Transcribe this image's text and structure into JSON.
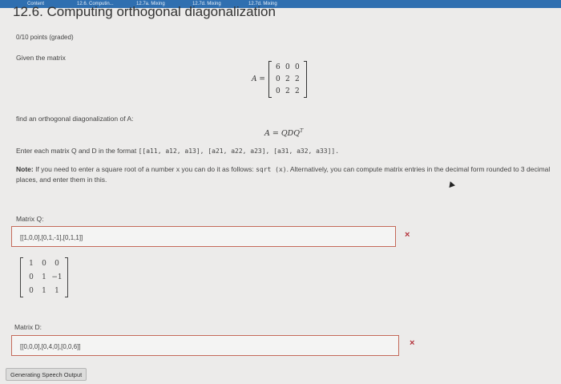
{
  "tabs": [
    {
      "label": "Content"
    },
    {
      "label": "12.6. Computin..."
    },
    {
      "label": "12.7a. Mixing"
    },
    {
      "label": "12.7d. Mixing"
    },
    {
      "label": "12.7d. Mixing"
    }
  ],
  "page_title": "12.6. Computing orthogonal diagonalization",
  "points": "0/10 points (graded)",
  "given_text": "Given the matrix",
  "matrix_A": {
    "lhs": "A =",
    "rows": [
      [
        "6",
        "0",
        "0"
      ],
      [
        "0",
        "2",
        "2"
      ],
      [
        "0",
        "2",
        "2"
      ]
    ]
  },
  "find_text": "find an orthogonal diagonalization of A:",
  "equation": {
    "lhs": "A = QDQ",
    "sup": "T"
  },
  "format_text": {
    "prefix": "Enter each matrix Q and D in the format",
    "code": "[[a11, a12, a13], [a21, a22, a23], [a31, a32, a33]]."
  },
  "note": {
    "label": "Note:",
    "text_1": " If you need to enter a square root of a number x you can do it as follows: ",
    "code": "sqrt (x)",
    "text_2": ". Alternatively, you can compute matrix entries in the decimal form rounded to 3 decimal places, and enter them in this."
  },
  "matrix_Q": {
    "label": "Matrix Q:",
    "value": "[[1,0,0],[0,1,-1],[0,1,1]]",
    "preview_rows": [
      [
        "1",
        "0",
        "0"
      ],
      [
        "0",
        "1",
        "−1"
      ],
      [
        "0",
        "1",
        "1"
      ]
    ],
    "status_mark": "×"
  },
  "matrix_D": {
    "label": "Matrix D:",
    "value": "[[0,0,0],[0,4,0],[0,0,6]]",
    "status_mark": "×"
  },
  "speech_button": "Generating Speech Output",
  "colors": {
    "error": "#b3313a",
    "tabbar": "#2f6fb0",
    "box_border": "#c46a5a"
  }
}
